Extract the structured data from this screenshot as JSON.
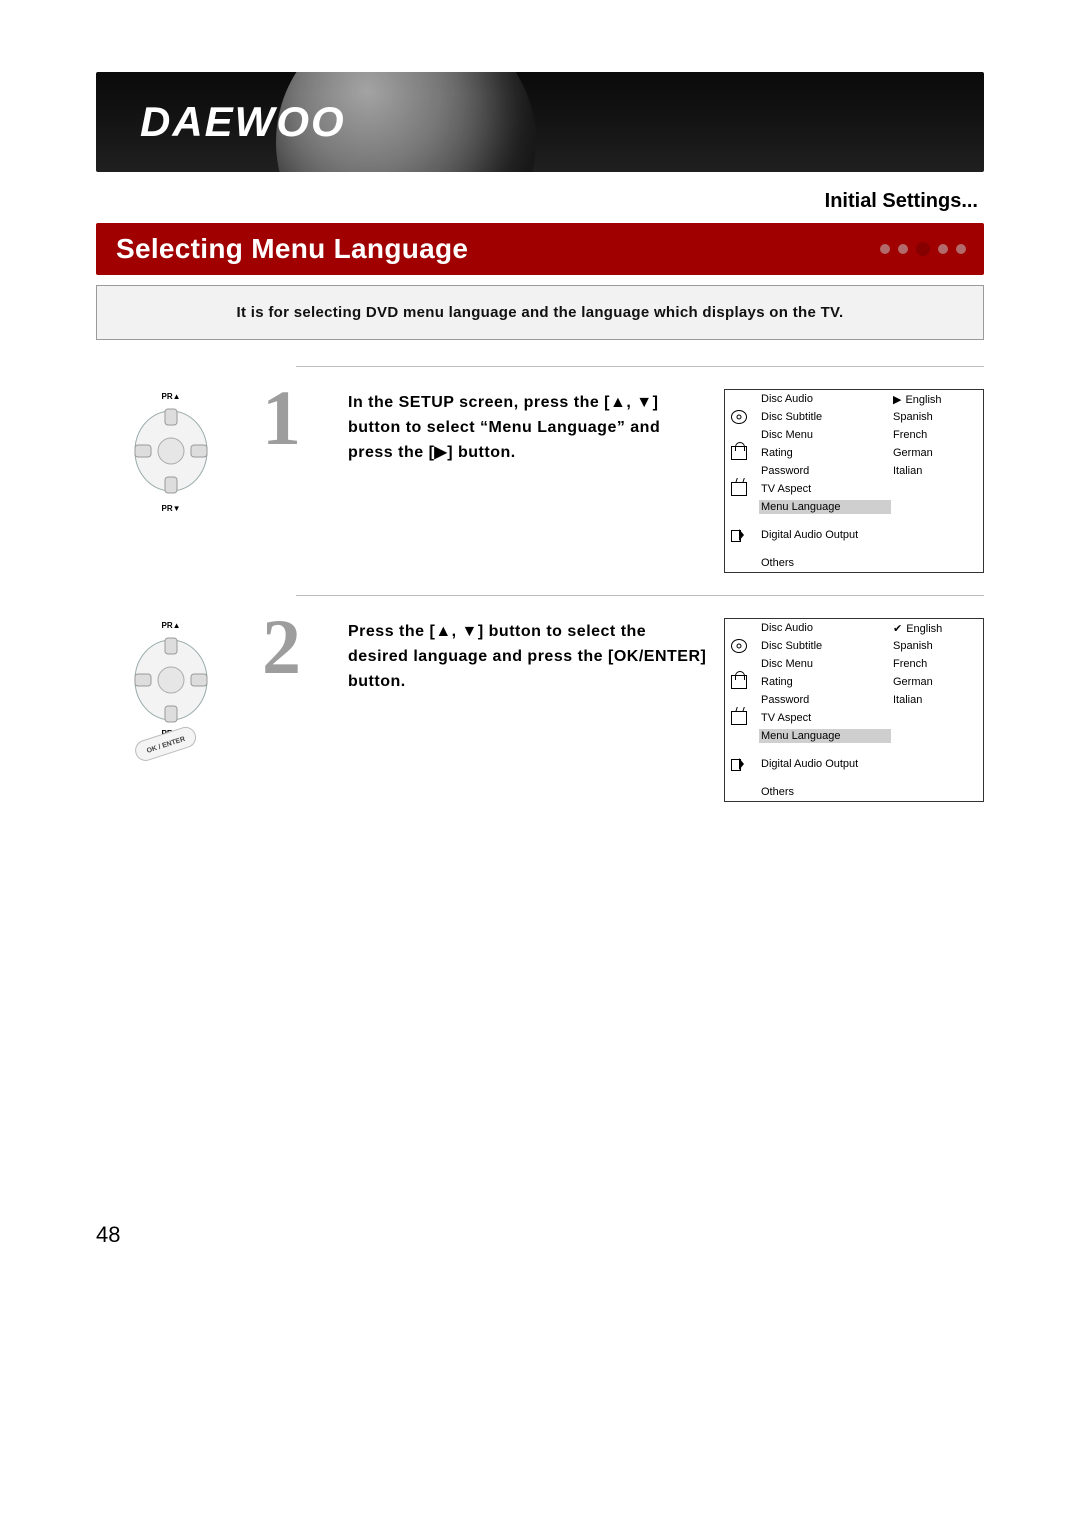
{
  "brand": "DAEWOO",
  "breadcrumb": "Initial Settings...",
  "title": "Selecting Menu Language",
  "intro": "It is for selecting DVD menu language and the language which displays on the TV.",
  "remote_labels": {
    "up": "PR▲",
    "down": "PR▼",
    "ok": "OK / ENTER"
  },
  "menu": {
    "items": [
      "Disc Audio",
      "Disc Subtitle",
      "Disc Menu",
      "Rating",
      "Password",
      "TV Aspect",
      "Menu Language",
      "Digital Audio Output",
      "Others"
    ],
    "languages": [
      "English",
      "Spanish",
      "French",
      "German",
      "Italian"
    ]
  },
  "steps": [
    {
      "num": "1",
      "text": "In the SETUP screen, press the [▲, ▼] button to select “Menu Language” and press the [▶] button.",
      "selected_menu_item": "Menu Language",
      "lang_marker": "▶",
      "lang_marked": "English"
    },
    {
      "num": "2",
      "text": "Press the [▲, ▼] button to select the desired language and press the [OK/ENTER] button.",
      "selected_menu_item": "Menu Language",
      "lang_marker": "✔",
      "lang_marked": "English"
    }
  ],
  "page_number": "48"
}
